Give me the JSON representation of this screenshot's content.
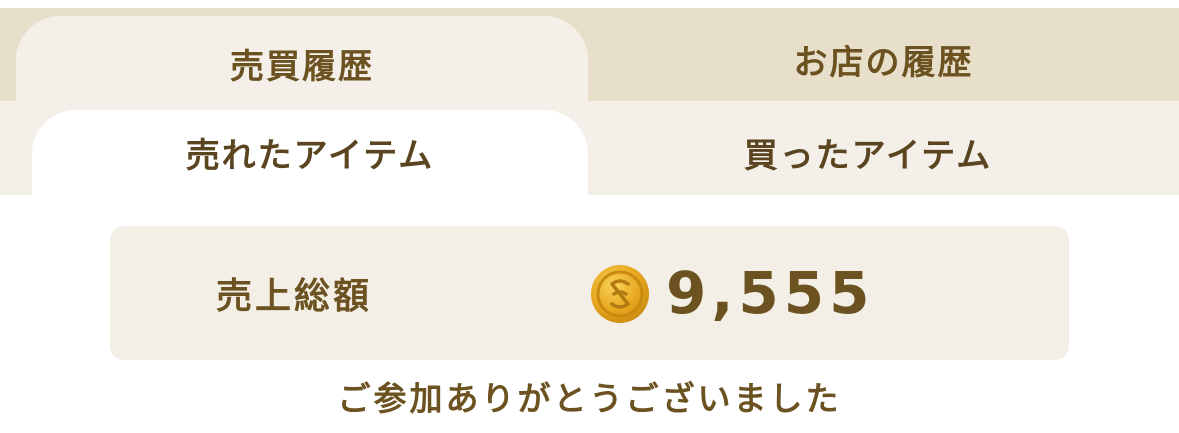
{
  "main_tabs": [
    {
      "label": "売買履歴",
      "active": true
    },
    {
      "label": "お店の履歴",
      "active": false
    }
  ],
  "sub_tabs": [
    {
      "label": "売れたアイテム",
      "active": true
    },
    {
      "label": "買ったアイテム",
      "active": false
    }
  ],
  "summary": {
    "label": "売上総額",
    "amount": "9,555",
    "icon": "coin-icon"
  },
  "message": "ご参加ありがとうございました",
  "colors": {
    "text": "#6b5220",
    "tab_bar": "#e8dfcb",
    "active_tab": "#f4f0e9",
    "summary_bg": "#f3efe6",
    "coin_gold": "#e8a820"
  }
}
